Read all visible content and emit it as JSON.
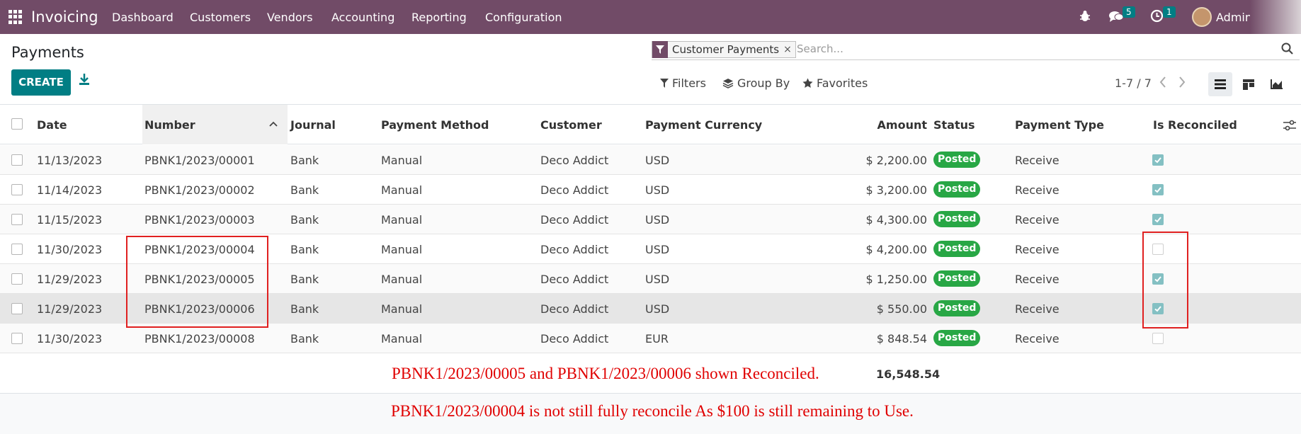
{
  "navbar": {
    "app_name": "Invoicing",
    "menu": [
      "Dashboard",
      "Customers",
      "Vendors",
      "Accounting",
      "Reporting",
      "Configuration"
    ],
    "messages_count": "5",
    "activities_count": "1",
    "user": "Admin",
    "bg_color": "#714b67"
  },
  "control_panel": {
    "title": "Payments",
    "create_label": "CREATE",
    "facet_label": "Customer Payments",
    "facet_close": "×",
    "search_placeholder": "Search...",
    "filters_label": "Filters",
    "group_by_label": "Group By",
    "favorites_label": "Favorites",
    "pager": "1-7 / 7",
    "accent_color": "#017e84"
  },
  "table": {
    "headers": {
      "date": "Date",
      "number": "Number",
      "journal": "Journal",
      "payment_method": "Payment Method",
      "customer": "Customer",
      "payment_currency": "Payment Currency",
      "amount": "Amount",
      "status": "Status",
      "payment_type": "Payment Type",
      "is_reconciled": "Is Reconciled"
    },
    "sorted_column": "Number",
    "rows": [
      {
        "date": "11/13/2023",
        "number": "PBNK1/2023/00001",
        "journal": "Bank",
        "method": "Manual",
        "customer": "Deco Addict",
        "currency": "USD",
        "amount": "$ 2,200.00",
        "status": "Posted",
        "type": "Receive",
        "reconciled": true
      },
      {
        "date": "11/14/2023",
        "number": "PBNK1/2023/00002",
        "journal": "Bank",
        "method": "Manual",
        "customer": "Deco Addict",
        "currency": "USD",
        "amount": "$ 3,200.00",
        "status": "Posted",
        "type": "Receive",
        "reconciled": true
      },
      {
        "date": "11/15/2023",
        "number": "PBNK1/2023/00003",
        "journal": "Bank",
        "method": "Manual",
        "customer": "Deco Addict",
        "currency": "USD",
        "amount": "$ 4,300.00",
        "status": "Posted",
        "type": "Receive",
        "reconciled": true
      },
      {
        "date": "11/30/2023",
        "number": "PBNK1/2023/00004",
        "journal": "Bank",
        "method": "Manual",
        "customer": "Deco Addict",
        "currency": "USD",
        "amount": "$ 4,200.00",
        "status": "Posted",
        "type": "Receive",
        "reconciled": false
      },
      {
        "date": "11/29/2023",
        "number": "PBNK1/2023/00005",
        "journal": "Bank",
        "method": "Manual",
        "customer": "Deco Addict",
        "currency": "USD",
        "amount": "$ 1,250.00",
        "status": "Posted",
        "type": "Receive",
        "reconciled": true
      },
      {
        "date": "11/29/2023",
        "number": "PBNK1/2023/00006",
        "journal": "Bank",
        "method": "Manual",
        "customer": "Deco Addict",
        "currency": "USD",
        "amount": "$ 550.00",
        "status": "Posted",
        "type": "Receive",
        "reconciled": true
      },
      {
        "date": "11/30/2023",
        "number": "PBNK1/2023/00008",
        "journal": "Bank",
        "method": "Manual",
        "customer": "Deco Addict",
        "currency": "EUR",
        "amount": "$ 848.54",
        "status": "Posted",
        "type": "Receive",
        "reconciled": false
      }
    ],
    "total_amount": "16,548.54",
    "status_color": "#28a745"
  },
  "annotations": {
    "note_1": "PBNK1/2023/00005 and PBNK1/2023/00006 shown Reconciled.",
    "note_2": "PBNK1/2023/00004 is not still fully reconcile As $100 is still remaining to Use.",
    "color": "#e00000"
  }
}
